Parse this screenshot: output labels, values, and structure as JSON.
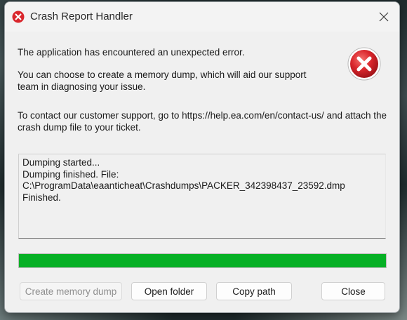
{
  "window": {
    "title": "Crash Report Handler",
    "title_icon": "error-icon",
    "close_icon": "close-icon"
  },
  "messages": {
    "line1": "The application has encountered an unexpected error.",
    "line2": "You can choose to create a memory dump, which will aid our support team in diagnosing your issue.",
    "line3": "To contact our customer support, go to https://help.ea.com/en/contact-us/ and attach the crash dump file to your ticket."
  },
  "log": {
    "lines": [
      "Dumping started...",
      "Dumping finished. File:",
      "C:\\ProgramData\\eaanticheat\\Crashdumps\\PACKER_342398437_23592.dmp",
      "Finished."
    ]
  },
  "progress": {
    "fraction": 1.0,
    "color": "#06b025"
  },
  "buttons": {
    "create_dump": "Create memory dump",
    "open_folder": "Open folder",
    "copy_path": "Copy path",
    "close": "Close"
  },
  "colors": {
    "error_red": "#d9262c",
    "accent_green": "#06b025"
  }
}
